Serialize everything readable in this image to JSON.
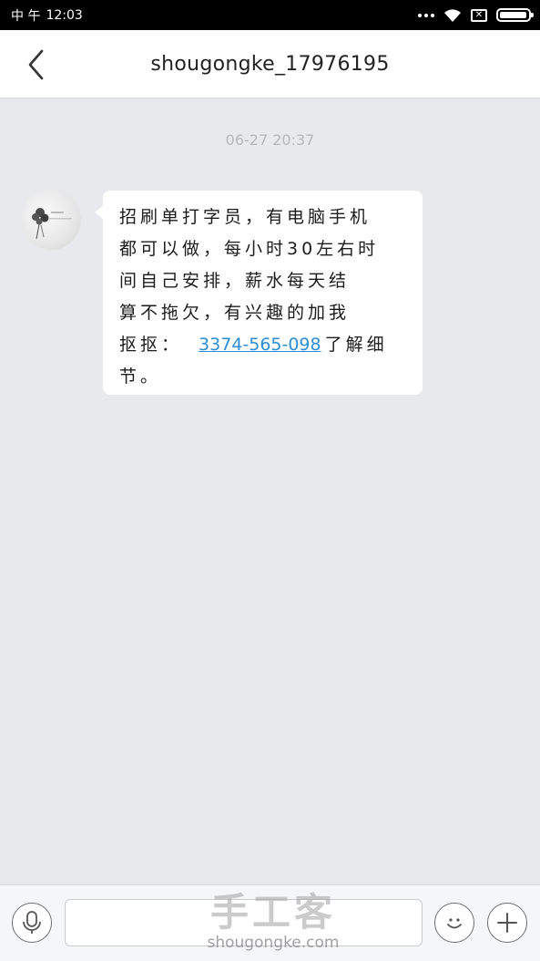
{
  "status_bar": {
    "carrier": "中 午",
    "time": "12:03",
    "sim_label": "✕",
    "battery_level": 0.95
  },
  "header": {
    "back_icon": "chevron-left-icon",
    "title": "shougongke_17976195"
  },
  "chat": {
    "timestamp": "06-27 20:37",
    "messages": [
      {
        "sender": "other",
        "lines": [
          "招刷单打字员，有电脑手机",
          "都可以做，每小时30左右时",
          "间自己安排，薪水每天结",
          "算不拖欠，有兴趣的加我"
        ],
        "line5_prefix": "抠抠：",
        "phone": "3374-565-098",
        "line5_suffix": "了解细",
        "line6": "节。"
      }
    ]
  },
  "input_bar": {
    "voice_icon": "microphone-icon",
    "input_placeholder": "",
    "emoji_icon": "smiley-icon",
    "plus_icon": "plus-icon"
  },
  "watermark": {
    "cn": "手工客",
    "en": "shougongke.com"
  }
}
